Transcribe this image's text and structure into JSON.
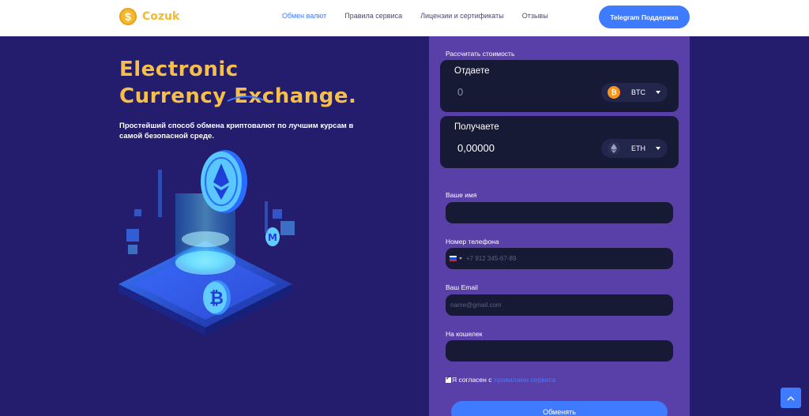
{
  "header": {
    "logo_text": "Cozuk",
    "nav": [
      {
        "label": "Обмен валют",
        "active": true
      },
      {
        "label": "Правила сервиса",
        "active": false
      },
      {
        "label": "Лицензии и сертификаты",
        "active": false
      },
      {
        "label": "Отзывы",
        "active": false
      }
    ],
    "cta_label": "Telegram Поддержка"
  },
  "hero": {
    "title_line1": "Electronic",
    "title_line2": "Currency Exchange.",
    "subtitle": "Простейший способ обмена криптовалют по лучшим курсам в самой безопасной среде."
  },
  "form": {
    "calc_label": "Рассчитать стоимость",
    "give": {
      "title": "Отдаете",
      "amount": "0",
      "coin": "BTC",
      "coin_icon": "bitcoin-icon"
    },
    "get": {
      "title": "Получаете",
      "amount": "0,00000",
      "coin": "ETH",
      "coin_icon": "ethereum-icon"
    },
    "name_label": "Ваше имя",
    "name_value": "",
    "phone_label": "Номер телефона",
    "phone_placeholder": "+7 912 345-67-89",
    "email_label": "Ваш Email",
    "email_placeholder": "name@gmail.com",
    "wallet_label": "На кошелек",
    "wallet_value": "",
    "agree_text": "Я согласен с",
    "agree_link": "правилами сервиса",
    "agree_checked": true,
    "submit_label": "Обменять"
  },
  "colors": {
    "background": "#241c6c",
    "panel": "#5940a8",
    "accent": "#3e7bff",
    "title": "#f6bf4a",
    "input_bg": "#171a35"
  }
}
